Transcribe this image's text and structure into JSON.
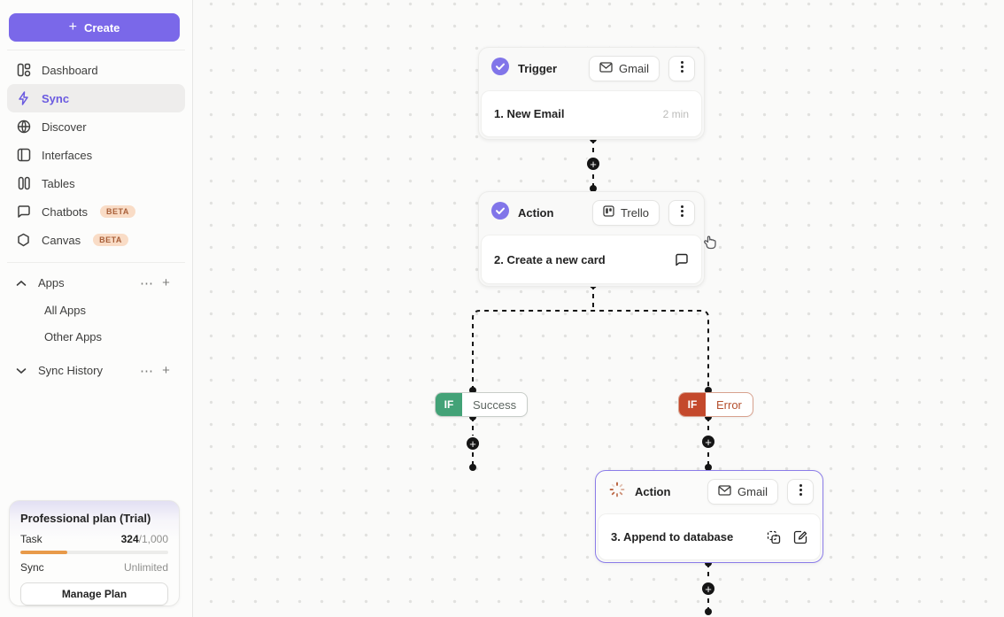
{
  "sidebar": {
    "create_label": "Create",
    "nav": [
      {
        "label": "Dashboard",
        "icon": "dashboard-icon"
      },
      {
        "label": "Sync",
        "icon": "sync-bolt-icon",
        "active": true
      },
      {
        "label": "Discover",
        "icon": "globe-icon"
      },
      {
        "label": "Interfaces",
        "icon": "interfaces-icon"
      },
      {
        "label": "Tables",
        "icon": "tables-icon"
      },
      {
        "label": "Chatbots",
        "icon": "chat-icon",
        "badge": "BETA"
      },
      {
        "label": "Canvas",
        "icon": "hexagon-icon",
        "badge": "BETA"
      }
    ],
    "apps_section": {
      "label": "Apps",
      "children": [
        {
          "label": "All Apps"
        },
        {
          "label": "Other Apps"
        }
      ]
    },
    "history_section": {
      "label": "Sync History"
    },
    "plan": {
      "title": "Professional plan (Trial)",
      "task_label": "Task",
      "task_used": "324",
      "task_total": "/1,000",
      "task_percent": 32,
      "sync_label": "Sync",
      "sync_value": "Unlimited",
      "manage_label": "Manage Plan"
    }
  },
  "canvas": {
    "nodes": [
      {
        "header": "Trigger",
        "app": "Gmail",
        "app_icon": "envelope-icon",
        "status_icon": "check-circle-icon",
        "step": "1. New Email",
        "meta": "2 min"
      },
      {
        "header": "Action",
        "app": "Trello",
        "app_icon": "trello-icon",
        "status_icon": "check-circle-icon",
        "step": "2. Create a new card"
      },
      {
        "header": "Action",
        "app": "Gmail",
        "app_icon": "envelope-icon",
        "status_icon": "spinner-icon",
        "step": "3. Append to database",
        "selected": true
      }
    ],
    "branches": [
      {
        "if": "IF",
        "label": "Success",
        "color": "#43a277"
      },
      {
        "if": "IF",
        "label": "Error",
        "color": "#c4492c"
      }
    ]
  },
  "colors": {
    "accent_purple": "#7a68e9",
    "success_green": "#43a277",
    "error_red": "#c4492c",
    "progress_orange": "#e89a4a",
    "connector_black": "#151515"
  }
}
